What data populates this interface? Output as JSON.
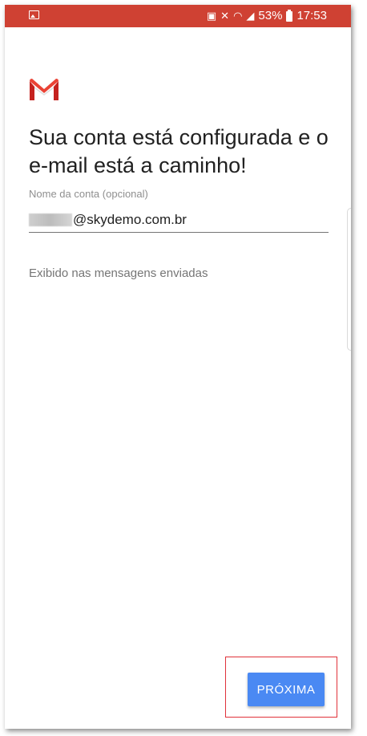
{
  "status_bar": {
    "battery_percent": "53%",
    "time": "17:53",
    "color": "#cf4133"
  },
  "app": {
    "logo_icon": "gmail-logo-icon"
  },
  "setup": {
    "title": "Sua conta está configurada e o e-mail está a caminho!",
    "account_name_label": "Nome da conta (opcional)",
    "account_name_value": "@skydemo.com.br",
    "helper_text": "Exibido nas mensagens enviadas"
  },
  "actions": {
    "next_label": "PRÓXIMA",
    "next_color": "#4a89f3"
  }
}
